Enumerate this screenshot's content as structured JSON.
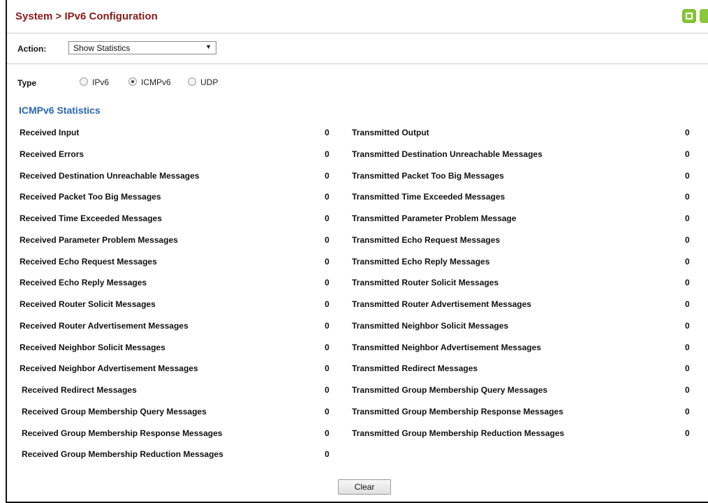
{
  "header": {
    "title": "System > IPv6 Configuration"
  },
  "action": {
    "label": "Action:",
    "selected": "Show Statistics"
  },
  "type": {
    "label": "Type",
    "options": [
      {
        "label": "IPv6",
        "checked": false
      },
      {
        "label": "ICMPv6",
        "checked": true
      },
      {
        "label": "UDP",
        "checked": false
      }
    ]
  },
  "section": {
    "title": "ICMPv6 Statistics"
  },
  "received": [
    {
      "label": "Received Input",
      "value": "0"
    },
    {
      "label": "Received Errors",
      "value": "0"
    },
    {
      "label": "Received Destination Unreachable Messages",
      "value": "0"
    },
    {
      "label": "Received Packet Too Big Messages",
      "value": "0"
    },
    {
      "label": "Received Time Exceeded Messages",
      "value": "0"
    },
    {
      "label": "Received Parameter Problem Messages",
      "value": "0"
    },
    {
      "label": "Received Echo Request Messages",
      "value": "0"
    },
    {
      "label": "Received Echo Reply Messages",
      "value": "0"
    },
    {
      "label": "Received Router Solicit Messages",
      "value": "0"
    },
    {
      "label": "Received Router Advertisement Messages",
      "value": "0"
    },
    {
      "label": "Received Neighbor Solicit Messages",
      "value": "0"
    },
    {
      "label": "Received Neighbor Advertisement Messages",
      "value": "0"
    },
    {
      "label": "Received Redirect Messages",
      "value": "0"
    },
    {
      "label": "Received Group Membership Query Messages",
      "value": "0"
    },
    {
      "label": "Received Group Membership Response Messages",
      "value": "0"
    },
    {
      "label": "Received Group Membership Reduction Messages",
      "value": "0"
    }
  ],
  "transmitted": [
    {
      "label": "Transmitted Output",
      "value": "0"
    },
    {
      "label": "Transmitted Destination Unreachable Messages",
      "value": "0"
    },
    {
      "label": "Transmitted Packet Too Big Messages",
      "value": "0"
    },
    {
      "label": "Transmitted Time Exceeded Messages",
      "value": "0"
    },
    {
      "label": "Transmitted Parameter Problem Message",
      "value": "0"
    },
    {
      "label": "Transmitted Echo Request Messages",
      "value": "0"
    },
    {
      "label": "Transmitted Echo Reply Messages",
      "value": "0"
    },
    {
      "label": "Transmitted Router Solicit Messages",
      "value": "0"
    },
    {
      "label": "Transmitted Router Advertisement Messages",
      "value": "0"
    },
    {
      "label": "Transmitted Neighbor Solicit Messages",
      "value": "0"
    },
    {
      "label": "Transmitted Neighbor Advertisement Messages",
      "value": "0"
    },
    {
      "label": "Transmitted Redirect Messages",
      "value": "0"
    },
    {
      "label": "Transmitted Group Membership Query Messages",
      "value": "0"
    },
    {
      "label": "Transmitted Group Membership Response Messages",
      "value": "0"
    },
    {
      "label": "Transmitted Group Membership Reduction Messages",
      "value": "0"
    }
  ],
  "buttons": {
    "clear_label": "Clear"
  },
  "icons": {
    "save": "save-icon",
    "toolbar_partial": "toolbar-icon"
  },
  "colors": {
    "title": "#8b1b1b",
    "section": "#2a66b3",
    "icon_green": "#8bc63b"
  }
}
